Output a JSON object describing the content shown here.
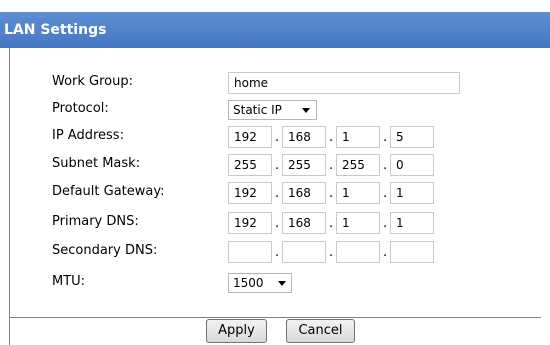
{
  "panel": {
    "title": "LAN Settings"
  },
  "fields": {
    "work_group": {
      "label": "Work Group:",
      "value": "home"
    },
    "protocol": {
      "label": "Protocol:",
      "value": "Static IP"
    },
    "ip_address": {
      "label": "IP Address:",
      "octets": [
        "192",
        "168",
        "1",
        "5"
      ]
    },
    "subnet_mask": {
      "label": "Subnet Mask:",
      "octets": [
        "255",
        "255",
        "255",
        "0"
      ]
    },
    "default_gateway": {
      "label": "Default Gateway:",
      "octets": [
        "192",
        "168",
        "1",
        "1"
      ]
    },
    "primary_dns": {
      "label": "Primary DNS:",
      "octets": [
        "192",
        "168",
        "1",
        "1"
      ]
    },
    "secondary_dns": {
      "label": "Secondary DNS:",
      "octets": [
        "",
        "",
        "",
        ""
      ]
    },
    "mtu": {
      "label": "MTU:",
      "value": "1500"
    }
  },
  "actions": {
    "apply_label": "Apply",
    "cancel_label": "Cancel"
  },
  "colors": {
    "header_bg": "#4a7cc7",
    "header_text": "#ffffff"
  }
}
